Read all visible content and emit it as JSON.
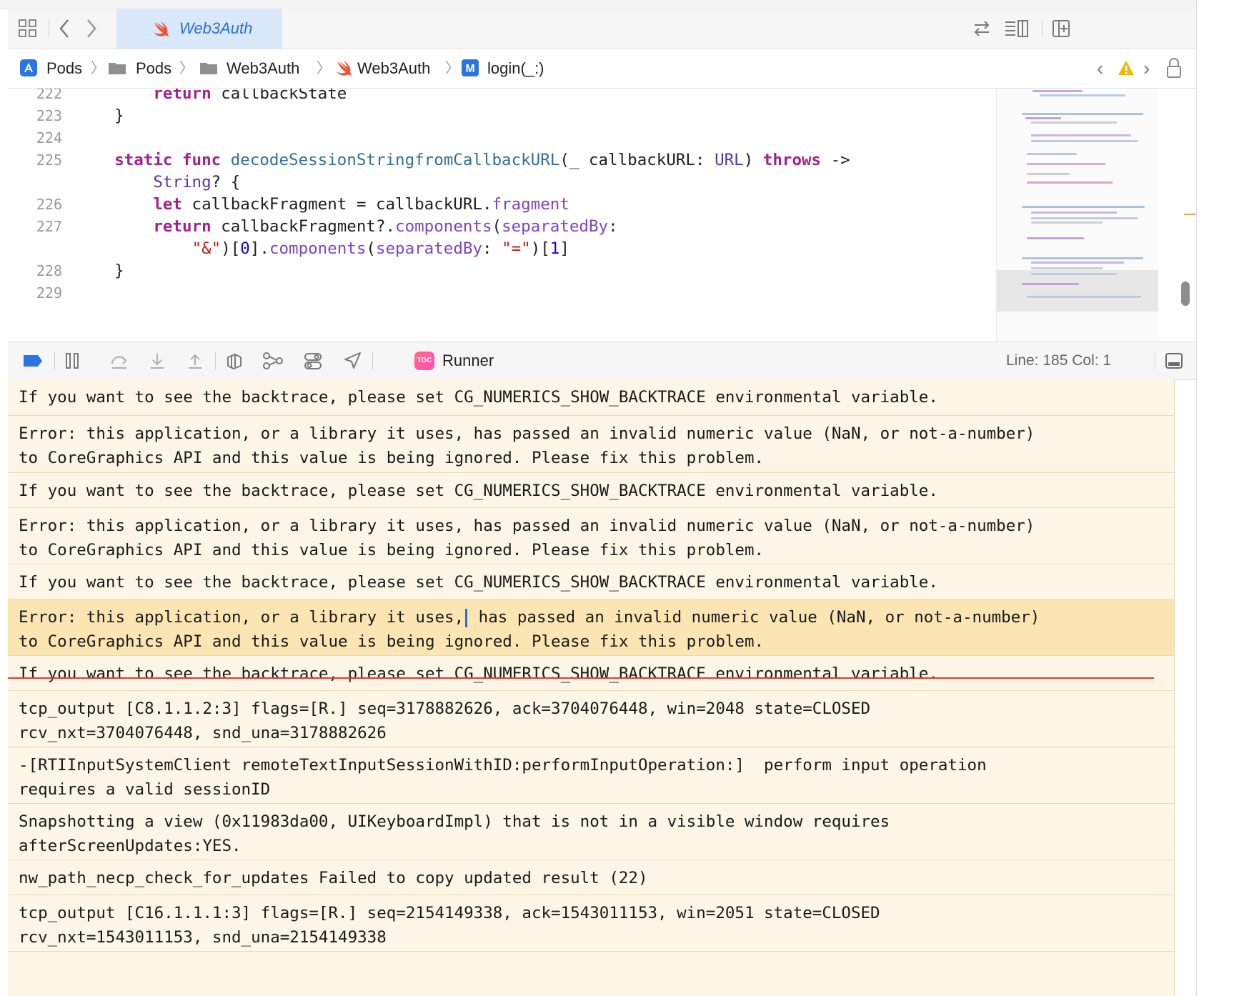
{
  "tabbar": {
    "tab_title": "Web3Auth"
  },
  "breadcrumb": {
    "items": [
      "Pods",
      "Pods",
      "Web3Auth",
      "Web3Auth",
      "login(_:)"
    ]
  },
  "editor": {
    "lines": [
      {
        "n": "222",
        "text": "        return callbackState"
      },
      {
        "n": "223",
        "text": "    }"
      },
      {
        "n": "224",
        "text": ""
      },
      {
        "n": "225",
        "text": "    static func decodeSessionStringfromCallbackURL(_ callbackURL: URL) throws ->"
      },
      {
        "n": "",
        "text": "        String? {"
      },
      {
        "n": "226",
        "text": "        let callbackFragment = callbackURL.fragment"
      },
      {
        "n": "227",
        "text": "        return callbackFragment?.components(separatedBy:"
      },
      {
        "n": "",
        "text": "            \"&\")[0].components(separatedBy: \"=\")[1]"
      },
      {
        "n": "228",
        "text": "    }"
      },
      {
        "n": "229",
        "text": ""
      }
    ]
  },
  "debugbar": {
    "scheme": "Runner",
    "scheme_icon_text": "TGC",
    "line_col": "Line: 185  Col: 1"
  },
  "console": {
    "messages": [
      "If you want to see the backtrace, please set CG_NUMERICS_SHOW_BACKTRACE environmental variable.",
      "Error: this application, or a library it uses, has passed an invalid numeric value (NaN, or not-a-number)\nto CoreGraphics API and this value is being ignored. Please fix this problem.",
      "If you want to see the backtrace, please set CG_NUMERICS_SHOW_BACKTRACE environmental variable.",
      "Error: this application, or a library it uses, has passed an invalid numeric value (NaN, or not-a-number)\nto CoreGraphics API and this value is being ignored. Please fix this problem.",
      "If you want to see the backtrace, please set CG_NUMERICS_SHOW_BACKTRACE environmental variable.",
      "Error: this application, or a library it uses,",
      " has passed an invalid numeric value (NaN, or not-a-number)\nto CoreGraphics API and this value is being ignored. Please fix this problem.",
      "If you want to see the backtrace, please set CG_NUMERICS_SHOW_BACKTRACE environmental variable.",
      "tcp_output [C8.1.1.2:3] flags=[R.] seq=3178882626, ack=3704076448, win=2048 state=CLOSED\nrcv_nxt=3704076448, snd_una=3178882626",
      "-[RTIInputSystemClient remoteTextInputSessionWithID:performInputOperation:]  perform input operation\nrequires a valid sessionID",
      "Snapshotting a view (0x11983da00, UIKeyboardImpl) that is not in a visible window requires\nafterScreenUpdates:YES.",
      "nw_path_necp_check_for_updates Failed to copy updated result (22)",
      "tcp_output [C16.1.1.1:3] flags=[R.] seq=2154149338, ack=1543011153, win=2051 state=CLOSED\nrcv_nxt=1543011153, snd_una=2154149338"
    ]
  }
}
